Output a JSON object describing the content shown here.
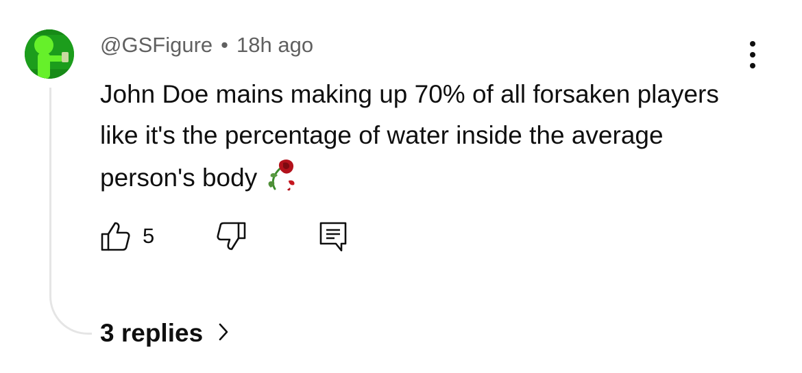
{
  "comment": {
    "author": "@GSFigure",
    "separator": "•",
    "timestamp": "18h ago",
    "text": "John Doe mains making up 70% of all forsaken players like it's the percentage of water inside the average person's body",
    "emoji_icon": "wilted-rose-icon"
  },
  "actions": {
    "like_count": "5"
  },
  "replies": {
    "label": "3 replies"
  },
  "colors": {
    "avatar_background": "#1c9d1c",
    "avatar_figure": "#66f02a",
    "text_primary": "#0f0f0f",
    "text_secondary": "#606060",
    "thread_line": "#e5e5e5"
  }
}
